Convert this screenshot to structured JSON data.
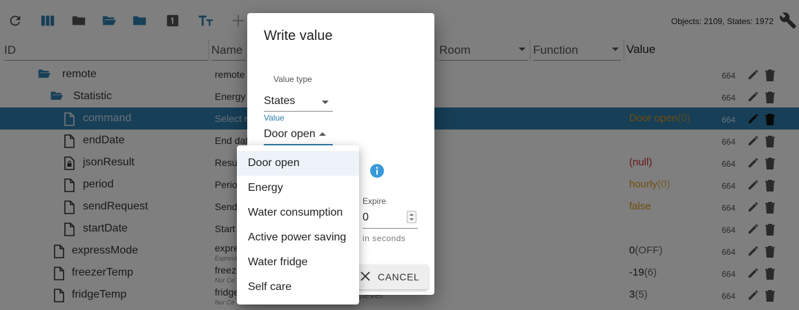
{
  "toolbar": {
    "stats": "Objects: 2109, States: 1972",
    "icons": [
      "refresh-icon",
      "columns-icon",
      "folder-icon",
      "folder-open-icon",
      "folder-icon",
      "number-1-icon",
      "text-size-icon",
      "plus-icon",
      "wrench-icon"
    ]
  },
  "columns": {
    "id": "ID",
    "name": "Name",
    "room": "Room",
    "function": "Function",
    "value": "Value"
  },
  "rows": [
    {
      "id": "remote",
      "name": "remote",
      "sub": "",
      "value": "",
      "num": "664",
      "type": "folder-open"
    },
    {
      "id": "Statistic",
      "name": "Energy",
      "sub": "",
      "value": "",
      "num": "664",
      "type": "folder-open"
    },
    {
      "id": "command",
      "name": "Select re",
      "sub": "",
      "value": "Door open",
      "value_suffix": "(0)",
      "num": "664",
      "type": "file"
    },
    {
      "id": "endDate",
      "name": "End dat",
      "sub": "",
      "value": "",
      "num": "664",
      "type": "file"
    },
    {
      "id": "jsonResult",
      "name": "Resul",
      "sub": "",
      "value": "(null)",
      "num": "664",
      "type": "file-lock"
    },
    {
      "id": "period",
      "name": "Perio",
      "sub": "",
      "value": "hourly",
      "value_suffix": "(0)",
      "num": "664",
      "type": "file"
    },
    {
      "id": "sendRequest",
      "name": "Send",
      "sub": "",
      "value": "false",
      "num": "664",
      "type": "file"
    },
    {
      "id": "startDate",
      "name": "Start",
      "sub": "",
      "value": "",
      "num": "664",
      "type": "file"
    },
    {
      "id": "expressMode",
      "name": "expre",
      "sub": "Express",
      "value": "0",
      "value_suffix": "(OFF)",
      "num": "664",
      "type": "file"
    },
    {
      "id": "freezerTemp",
      "name": "freeze",
      "sub": "Nur Ce",
      "value": "-19",
      "value_suffix": "(6)",
      "num": "664",
      "type": "file"
    },
    {
      "id": "fridgeTemp",
      "name": "fridge",
      "sub": "Nur Ce",
      "extra": "never",
      "value": "3",
      "value_suffix": "(5)",
      "num": "664",
      "type": "file"
    }
  ],
  "dialog": {
    "title": "Write value",
    "value_type_label": "Value type",
    "value_type": "States",
    "value_label": "Value",
    "value": "Door open",
    "expire_label": "Expire",
    "expire_value": "0",
    "expire_help": "in seconds",
    "cancel": "CANCEL"
  },
  "menu": {
    "options": [
      "Door open",
      "Energy",
      "Water consumption",
      "Active power saving",
      "Water fridge",
      "Self care"
    ],
    "selected": "Door open"
  },
  "colors": {
    "accent": "#2f7fae",
    "value_orange": "#e09a1a",
    "value_red": "#d32f2f",
    "info_blue": "#3a9ad9"
  }
}
